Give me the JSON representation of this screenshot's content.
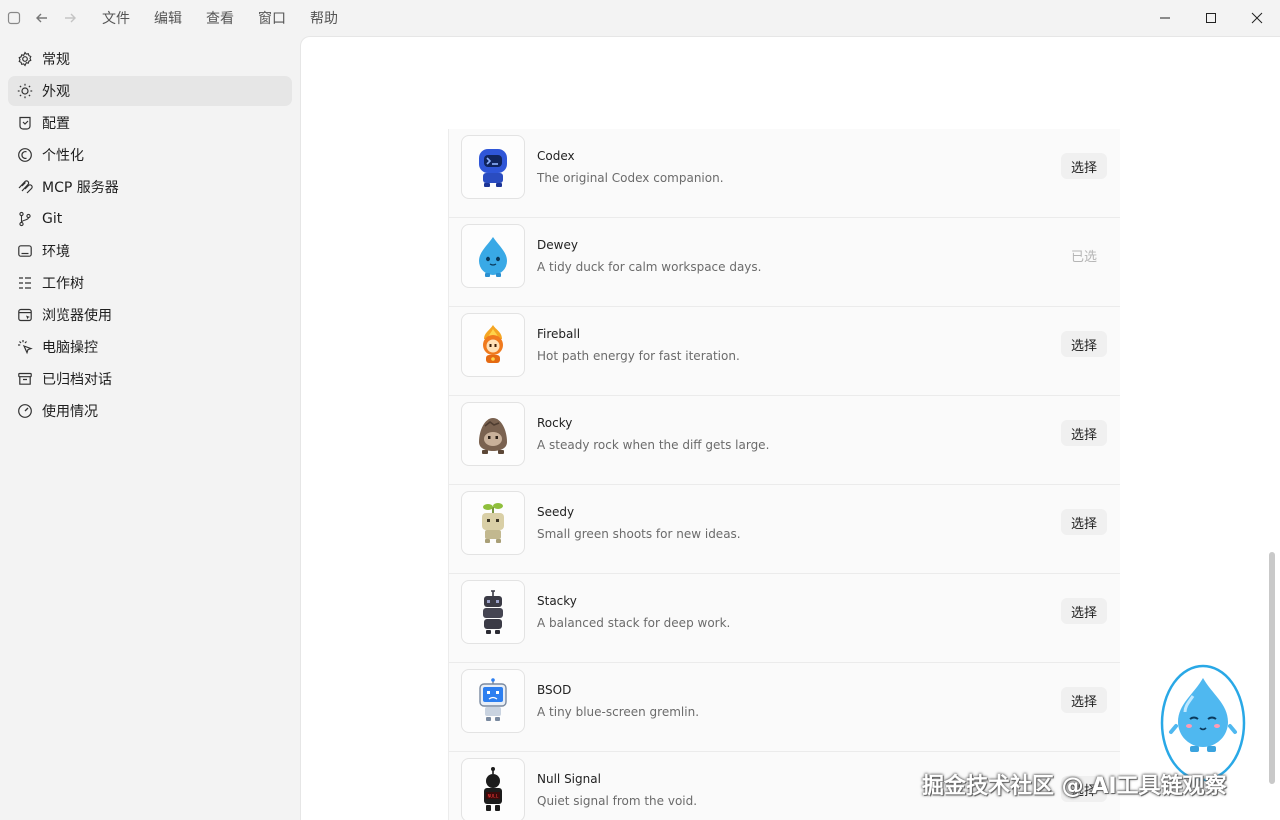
{
  "menu": [
    "文件",
    "编辑",
    "查看",
    "窗口",
    "帮助"
  ],
  "sidebar": {
    "items": [
      {
        "label": "常规",
        "icon": "gear-icon"
      },
      {
        "label": "外观",
        "icon": "sun-icon",
        "active": true
      },
      {
        "label": "配置",
        "icon": "config-icon"
      },
      {
        "label": "个性化",
        "icon": "personalize-icon"
      },
      {
        "label": "MCP 服务器",
        "icon": "mcp-icon"
      },
      {
        "label": "Git",
        "icon": "git-branch-icon"
      },
      {
        "label": "环境",
        "icon": "environment-icon"
      },
      {
        "label": "工作树",
        "icon": "worktree-icon"
      },
      {
        "label": "浏览器使用",
        "icon": "browser-icon"
      },
      {
        "label": "电脑操控",
        "icon": "computer-control-icon"
      },
      {
        "label": "已归档对话",
        "icon": "archive-icon"
      },
      {
        "label": "使用情况",
        "icon": "usage-gauge-icon"
      }
    ]
  },
  "pets": [
    {
      "name": "Codex",
      "description": "The original Codex companion.",
      "button": "选择",
      "selected": false,
      "color": "#2f56d8"
    },
    {
      "name": "Dewey",
      "description": "A tidy duck for calm workspace days.",
      "button": "已选",
      "selected": true,
      "color": "#39a9e6"
    },
    {
      "name": "Fireball",
      "description": "Hot path energy for fast iteration.",
      "button": "选择",
      "selected": false,
      "color": "#f07a1e"
    },
    {
      "name": "Rocky",
      "description": "A steady rock when the diff gets large.",
      "button": "选择",
      "selected": false,
      "color": "#7a6250"
    },
    {
      "name": "Seedy",
      "description": "Small green shoots for new ideas.",
      "button": "选择",
      "selected": false,
      "color": "#b7ad86"
    },
    {
      "name": "Stacky",
      "description": "A balanced stack for deep work.",
      "button": "选择",
      "selected": false,
      "color": "#3b3b46"
    },
    {
      "name": "BSOD",
      "description": "A tiny blue-screen gremlin.",
      "button": "选择",
      "selected": false,
      "color": "#2d7ff0"
    },
    {
      "name": "Null Signal",
      "description": "Quiet signal from the void.",
      "button": "选择",
      "selected": false,
      "color": "#1c1c1c"
    }
  ],
  "watermark": "掘金技术社区 @ AI工具链观察"
}
